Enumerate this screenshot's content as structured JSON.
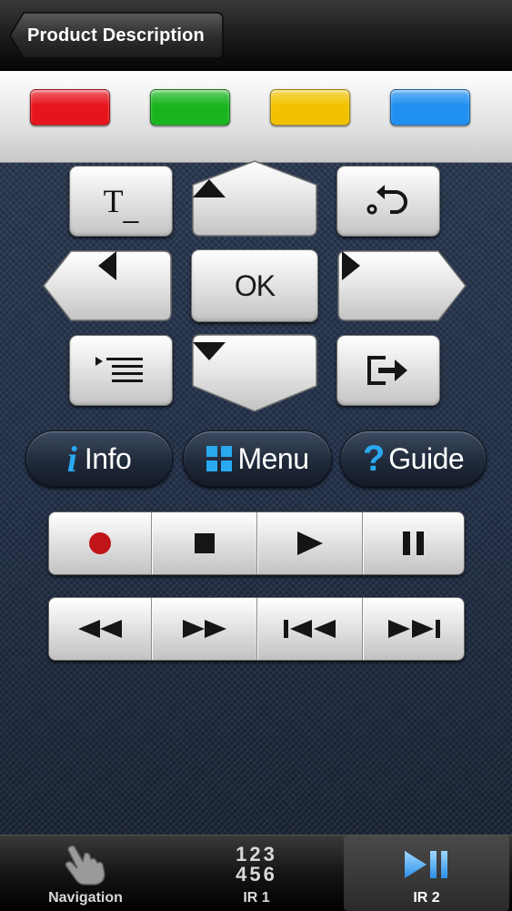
{
  "header": {
    "back_label": "Product Description"
  },
  "color_buttons": [
    {
      "name": "red",
      "color": "#e6141c"
    },
    {
      "name": "green",
      "color": "#19b51e"
    },
    {
      "name": "yellow",
      "color": "#f2c200"
    },
    {
      "name": "blue",
      "color": "#1f8ff0"
    }
  ],
  "dpad": {
    "ok_label": "OK"
  },
  "icons": {
    "teletext": "teletext-icon",
    "return": "return-icon",
    "tools": "tools-list-icon",
    "exit": "exit-icon",
    "up": "arrow-up-icon",
    "down": "arrow-down-icon",
    "left": "arrow-left-icon",
    "right": "arrow-right-icon"
  },
  "teletext_label": "T",
  "pills": {
    "info_symbol": "i",
    "info_label": "Info",
    "menu_label": "Menu",
    "guide_symbol": "?",
    "guide_label": "Guide"
  },
  "transport_rows": [
    [
      "record",
      "stop",
      "play",
      "pause"
    ],
    [
      "rewind",
      "fast-forward",
      "previous",
      "next"
    ]
  ],
  "tabbar": {
    "tabs": [
      {
        "label": "Navigation",
        "icon": "hand-pointer-icon"
      },
      {
        "label": "IR 1",
        "icon_line1": "123",
        "icon_line2": "456"
      },
      {
        "label": "IR 2",
        "icon": "play-pause-icon"
      }
    ],
    "active_index": 2
  }
}
